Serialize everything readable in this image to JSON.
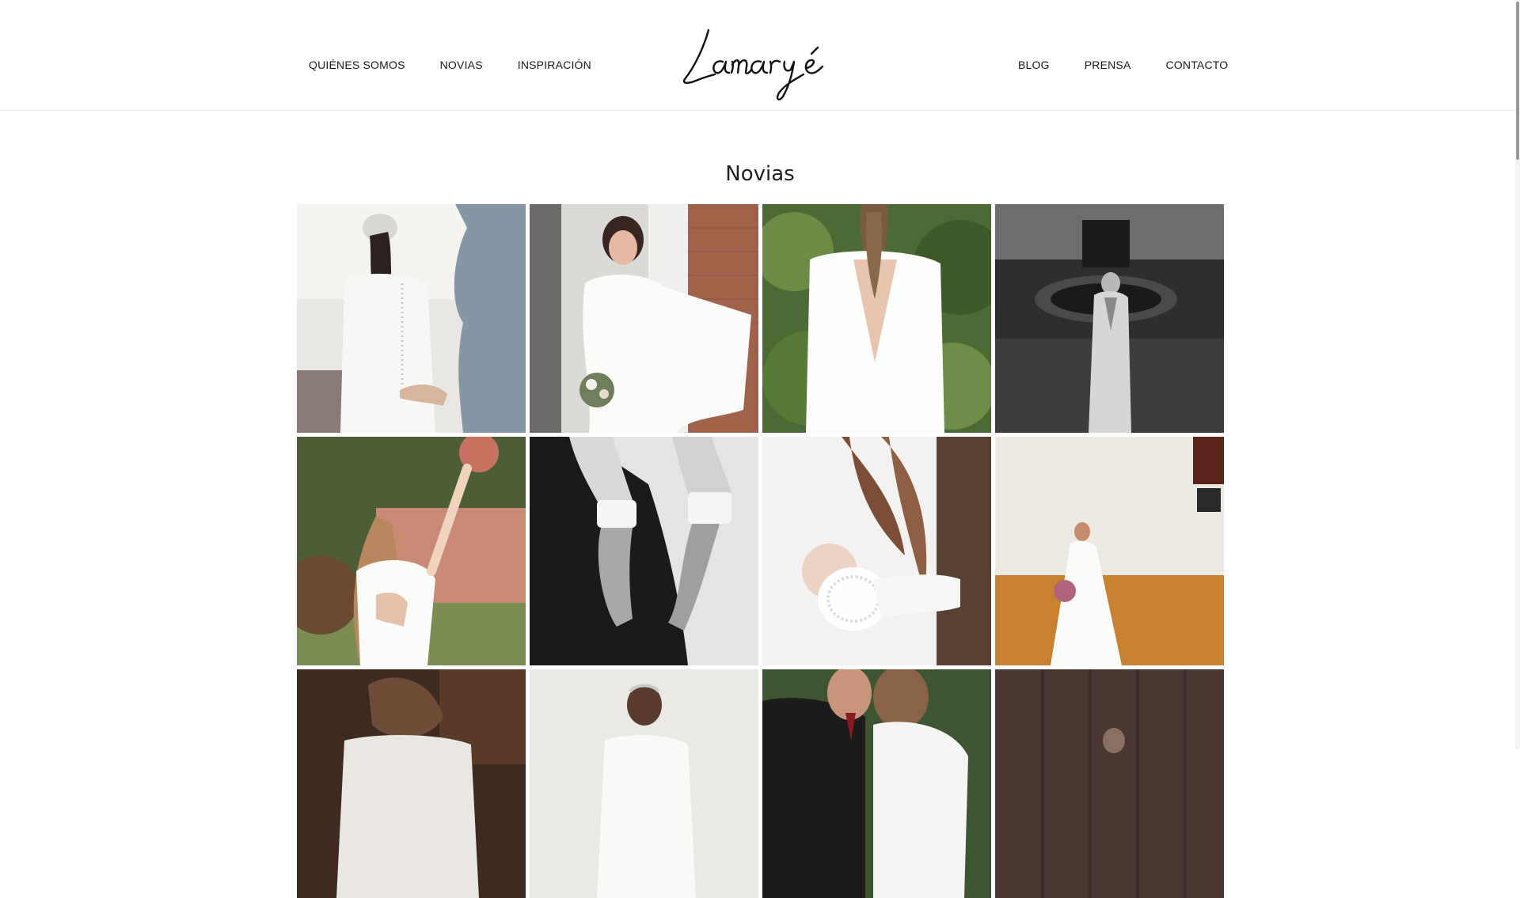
{
  "nav_left": [
    "QUIÉNES SOMOS",
    "NOVIAS",
    "INSPIRACIÓN"
  ],
  "nav_right": [
    "BLOG",
    "PRENSA",
    "CONTACTO"
  ],
  "logo_text": "Lamaryé",
  "page_title": "Novias",
  "gallery": [
    {
      "name": "bride-back-buttons-photo",
      "tone": "light"
    },
    {
      "name": "bride-smiling-cape-photo",
      "tone": "light"
    },
    {
      "name": "bride-open-back-garden-photo",
      "tone": "green"
    },
    {
      "name": "bride-fountain-bw-photo",
      "tone": "dark"
    },
    {
      "name": "bride-bouquet-raised-photo",
      "tone": "green"
    },
    {
      "name": "bride-lace-cuffs-bw-photo",
      "tone": "dark"
    },
    {
      "name": "bride-lace-sleeve-photo",
      "tone": "light"
    },
    {
      "name": "bride-orange-wall-photo",
      "tone": "warm"
    },
    {
      "name": "bride-braided-hair-photo",
      "tone": "dark"
    },
    {
      "name": "bride-tiara-photo",
      "tone": "light"
    },
    {
      "name": "couple-kiss-photo",
      "tone": "green"
    },
    {
      "name": "bride-door-photo",
      "tone": "dark"
    }
  ]
}
